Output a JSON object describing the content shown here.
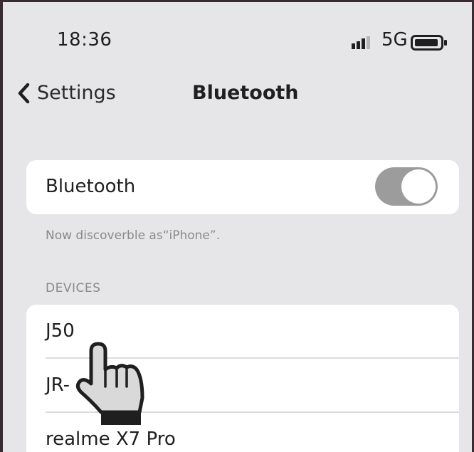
{
  "status_bar": {
    "time": "18:36",
    "network": "5G",
    "signal_icon": "signal-bars-icon",
    "battery_icon": "battery-icon"
  },
  "nav": {
    "back_label": "Settings",
    "title": "Bluetooth"
  },
  "bluetooth": {
    "label": "Bluetooth",
    "enabled": true,
    "footnote": "Now discoverble as“iPhone”."
  },
  "devices": {
    "header": "DEVICES",
    "items": [
      {
        "name": "J50"
      },
      {
        "name": "JR-"
      },
      {
        "name": "realme X7 Pro"
      }
    ]
  },
  "overlay": {
    "icon": "pointing-hand-icon"
  },
  "colors": {
    "background": "#e6e6e8",
    "card": "#ffffff",
    "toggle": "#9c9c9c",
    "frame": "#3a2a32"
  }
}
